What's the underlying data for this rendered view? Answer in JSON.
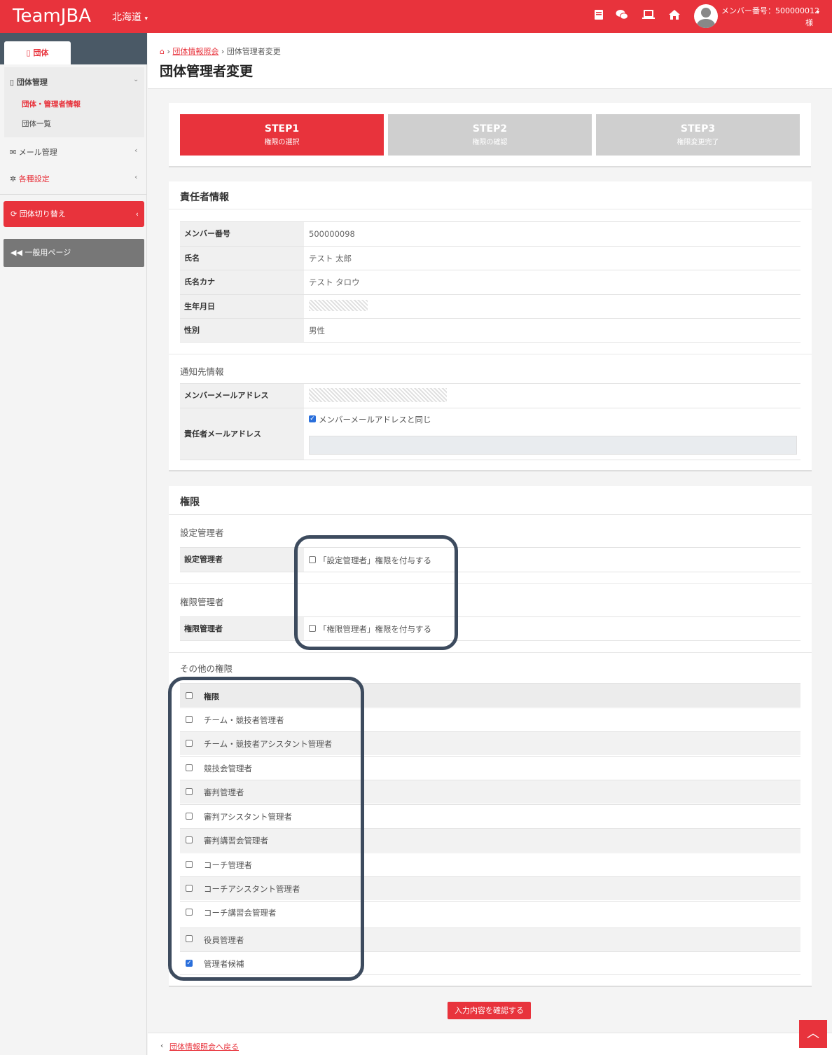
{
  "header": {
    "logo": "TeamJBA",
    "prefecture": "北海道",
    "member_label": "メンバー番号：500000012",
    "member_suffix": "様",
    "icons": [
      "book-icon",
      "chat-icon",
      "laptop-icon",
      "home-icon",
      "avatar-icon"
    ]
  },
  "sidebar": {
    "tab": "団体",
    "group_mgmt": "団体管理",
    "group_info": "団体・管理者情報",
    "group_list": "団体一覧",
    "mail_mgmt": "メール管理",
    "settings": "各種設定",
    "switch_group": "団体切り替え",
    "general_page": "一般用ページ"
  },
  "breadcrumb": {
    "home": "⌂",
    "parent": "団体情報照会",
    "current": "団体管理者変更"
  },
  "page_title": "団体管理者変更",
  "steps": [
    {
      "title": "STEP1",
      "sub": "権限の選択",
      "active": true
    },
    {
      "title": "STEP2",
      "sub": "権限の確認",
      "active": false
    },
    {
      "title": "STEP3",
      "sub": "権限変更完了",
      "active": false
    }
  ],
  "responsible": {
    "heading": "責任者情報",
    "rows": [
      {
        "label": "メンバー番号",
        "value": "500000098"
      },
      {
        "label": "氏名",
        "value": "テスト 太郎"
      },
      {
        "label": "氏名カナ",
        "value": "テスト タロウ"
      },
      {
        "label": "生年月日",
        "value": ""
      },
      {
        "label": "性別",
        "value": "男性"
      }
    ]
  },
  "notify": {
    "heading": "通知先情報",
    "member_email_label": "メンバーメールアドレス",
    "responsible_email_label": "責任者メールアドレス",
    "same_as_member": "メンバーメールアドレスと同じ"
  },
  "auth": {
    "heading": "権限",
    "setting_mgr_heading": "設定管理者",
    "setting_mgr_label": "設定管理者",
    "setting_mgr_check": "「設定管理者」権限を付与する",
    "auth_mgr_heading": "権限管理者",
    "auth_mgr_label": "権限管理者",
    "auth_mgr_check": "「権限管理者」権限を付与する",
    "other_heading": "その他の権限",
    "col_header": "権限",
    "others": [
      {
        "label": "チーム・競技者管理者",
        "checked": false
      },
      {
        "label": "チーム・競技者アシスタント管理者",
        "checked": false
      },
      {
        "label": "競技会管理者",
        "checked": false
      },
      {
        "label": "審判管理者",
        "checked": false
      },
      {
        "label": "審判アシスタント管理者",
        "checked": false
      },
      {
        "label": "審判講習会管理者",
        "checked": false
      },
      {
        "label": "コーチ管理者",
        "checked": false
      },
      {
        "label": "コーチアシスタント管理者",
        "checked": false
      },
      {
        "label": "コーチ講習会管理者",
        "checked": false
      },
      {
        "label": "役員管理者",
        "checked": false
      },
      {
        "label": "管理者候補",
        "checked": true
      }
    ]
  },
  "submit_label": "入力内容を確認する",
  "back_label": "団体情報照会へ戻る",
  "totop": "︿"
}
